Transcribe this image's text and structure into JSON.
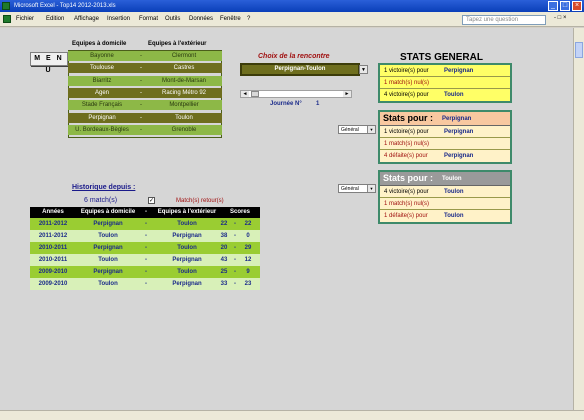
{
  "window": {
    "title": "Microsoft Excel - Top14  2012-2013.xls"
  },
  "menu": [
    "Fichier",
    "Edition",
    "Affichage",
    "Insertion",
    "Format",
    "Outils",
    "Données",
    "Fenêtre",
    "?"
  ],
  "help_placeholder": "Tapez une question",
  "menu_button": "M E N U",
  "matches": {
    "home_header": "Equipes à domicile",
    "away_header": "Equipes à l'extérieur",
    "rows": [
      {
        "home": "Bayonne",
        "sep": "-",
        "away": "Clermont",
        "style": "light"
      },
      {
        "home": "Toulouse",
        "sep": "-",
        "away": "Castres",
        "style": "dark"
      },
      {
        "home": "Biarritz",
        "sep": "-",
        "away": "Mont-de-Marsan",
        "style": "light"
      },
      {
        "home": "Agen",
        "sep": "-",
        "away": "Racing Métro 92",
        "style": "dark"
      },
      {
        "home": "Stade Français",
        "sep": "-",
        "away": "Montpellier",
        "style": "light"
      },
      {
        "home": "Perpignan",
        "sep": "-",
        "away": "Toulon",
        "style": "dark"
      },
      {
        "home": "U. Bordeaux-Bègles",
        "sep": "-",
        "away": "Grenoble",
        "style": "light"
      }
    ]
  },
  "choix": {
    "title": "Choix de la rencontre",
    "selected": "Perpignan-Toulon",
    "journee_label": "Journée N°",
    "journee_value": "1"
  },
  "stats_general": {
    "title": "STATS GENERAL",
    "lines": [
      {
        "text": "1 victoire(s) pour",
        "team": "Perpignan"
      },
      {
        "text": "1 match(s) nul(s)",
        "team": ""
      },
      {
        "text": "4 victoire(s) pour",
        "team": "Toulon"
      }
    ]
  },
  "stats_home": {
    "label": "Stats pour :",
    "team": "Perpignan",
    "dropdown": "Général",
    "lines": [
      {
        "text": "1 victoire(s) pour",
        "team": "Perpignan"
      },
      {
        "text": "1 match(s) nul(s)",
        "team": ""
      },
      {
        "text": "4 défaite(s) pour",
        "team": "Perpignan"
      }
    ]
  },
  "stats_away": {
    "label": "Stats pour :",
    "team": "Toulon",
    "dropdown": "Général",
    "lines": [
      {
        "text": "4 victoire(s) pour",
        "team": "Toulon"
      },
      {
        "text": "1 match(s) nul(s)",
        "team": ""
      },
      {
        "text": "1 défaite(s) pour",
        "team": "Toulon"
      }
    ]
  },
  "historique": {
    "title": "Historique depuis :",
    "count": "6 match(s)",
    "retour_label": "Match(s) retour(s)",
    "headers": {
      "year": "Années",
      "home": "Equipes à domicile",
      "sep": "-",
      "away": "Equipes à l'extérieur",
      "scores": "Scores"
    },
    "rows": [
      {
        "year": "2011-2012",
        "home": "Perpignan",
        "sep": "-",
        "away": "Toulon",
        "s1": "22",
        "dash": "-",
        "s2": "22",
        "style": "green"
      },
      {
        "year": "2011-2012",
        "home": "Toulon",
        "sep": "-",
        "away": "Perpignan",
        "s1": "38",
        "dash": "-",
        "s2": "0",
        "style": "pale"
      },
      {
        "year": "2010-2011",
        "home": "Perpignan",
        "sep": "-",
        "away": "Toulon",
        "s1": "20",
        "dash": "-",
        "s2": "29",
        "style": "green"
      },
      {
        "year": "2010-2011",
        "home": "Toulon",
        "sep": "-",
        "away": "Perpignan",
        "s1": "43",
        "dash": "-",
        "s2": "12",
        "style": "pale"
      },
      {
        "year": "2009-2010",
        "home": "Perpignan",
        "sep": "-",
        "away": "Toulon",
        "s1": "25",
        "dash": "-",
        "s2": "9",
        "style": "green"
      },
      {
        "year": "2009-2010",
        "home": "Toulon",
        "sep": "-",
        "away": "Perpignan",
        "s1": "33",
        "dash": "-",
        "s2": "23",
        "style": "pale"
      }
    ]
  }
}
